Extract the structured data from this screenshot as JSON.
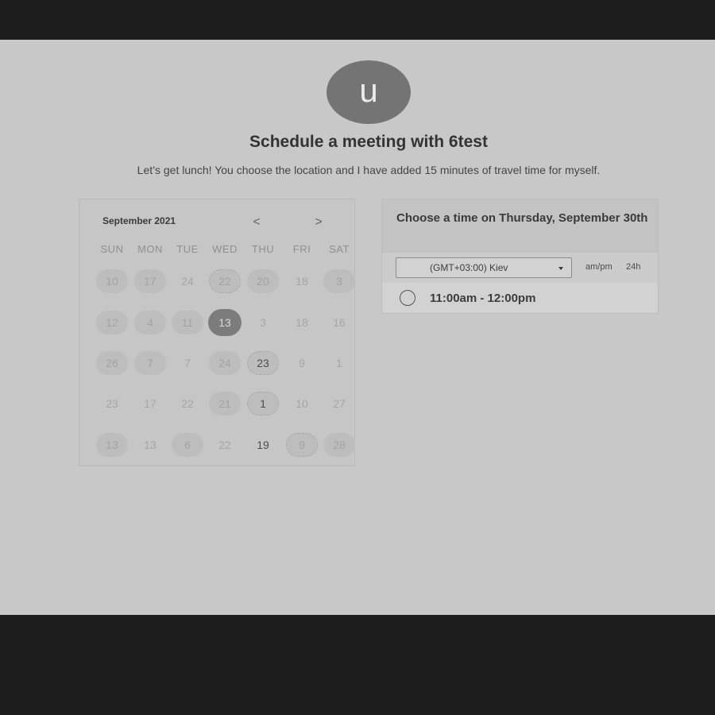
{
  "header": {
    "avatar_letter": "u",
    "title": "Schedule a meeting with 6test",
    "subtitle": "Let’s get lunch! You choose the location and I have added 15 minutes of travel time for myself."
  },
  "calendar": {
    "month": "September 2021",
    "prev_icon": "<",
    "next_icon": ">",
    "weekdays": [
      "SUN",
      "MON",
      "TUE",
      "WED",
      "THU",
      "FRI",
      "SAT"
    ],
    "weeks": [
      [
        {
          "d": "10",
          "s": "avail"
        },
        {
          "d": "17",
          "s": "avail"
        },
        {
          "d": "24",
          "s": ""
        },
        {
          "d": "22",
          "s": "avail ring"
        },
        {
          "d": "20",
          "s": "avail"
        },
        {
          "d": "18",
          "s": ""
        },
        {
          "d": "3",
          "s": "avail"
        }
      ],
      [
        {
          "d": "12",
          "s": "avail"
        },
        {
          "d": "4",
          "s": "avail"
        },
        {
          "d": "11",
          "s": "avail"
        },
        {
          "d": "13",
          "s": "selected"
        },
        {
          "d": "3",
          "s": ""
        },
        {
          "d": "18",
          "s": ""
        },
        {
          "d": "16",
          "s": ""
        }
      ],
      [
        {
          "d": "26",
          "s": "avail"
        },
        {
          "d": "7",
          "s": "avail"
        },
        {
          "d": "7",
          "s": ""
        },
        {
          "d": "24",
          "s": "avail"
        },
        {
          "d": "23",
          "s": "avail ring dark"
        },
        {
          "d": "9",
          "s": ""
        },
        {
          "d": "1",
          "s": ""
        }
      ],
      [
        {
          "d": "23",
          "s": ""
        },
        {
          "d": "17",
          "s": ""
        },
        {
          "d": "22",
          "s": ""
        },
        {
          "d": "21",
          "s": "avail"
        },
        {
          "d": "1",
          "s": "avail ring dark"
        },
        {
          "d": "10",
          "s": ""
        },
        {
          "d": "27",
          "s": ""
        }
      ],
      [
        {
          "d": "13",
          "s": "avail"
        },
        {
          "d": "13",
          "s": ""
        },
        {
          "d": "6",
          "s": "avail"
        },
        {
          "d": "22",
          "s": ""
        },
        {
          "d": "19",
          "s": "dark"
        },
        {
          "d": "9",
          "s": "avail ring"
        },
        {
          "d": "28",
          "s": "avail"
        }
      ]
    ]
  },
  "time_panel": {
    "title": "Choose a time on Thursday, September 30th",
    "timezone": "(GMT+03:00) Kiev",
    "format_ampm": "am/pm",
    "format_24h": "24h",
    "slots": [
      "11:00am - 12:00pm"
    ]
  },
  "colors": {
    "page_frame": "#1d1d1d",
    "page_background": "#c8c8c8",
    "avatar": "#747474",
    "selected_day": "#7c7c7c",
    "available_day": "#bdbdbd"
  }
}
